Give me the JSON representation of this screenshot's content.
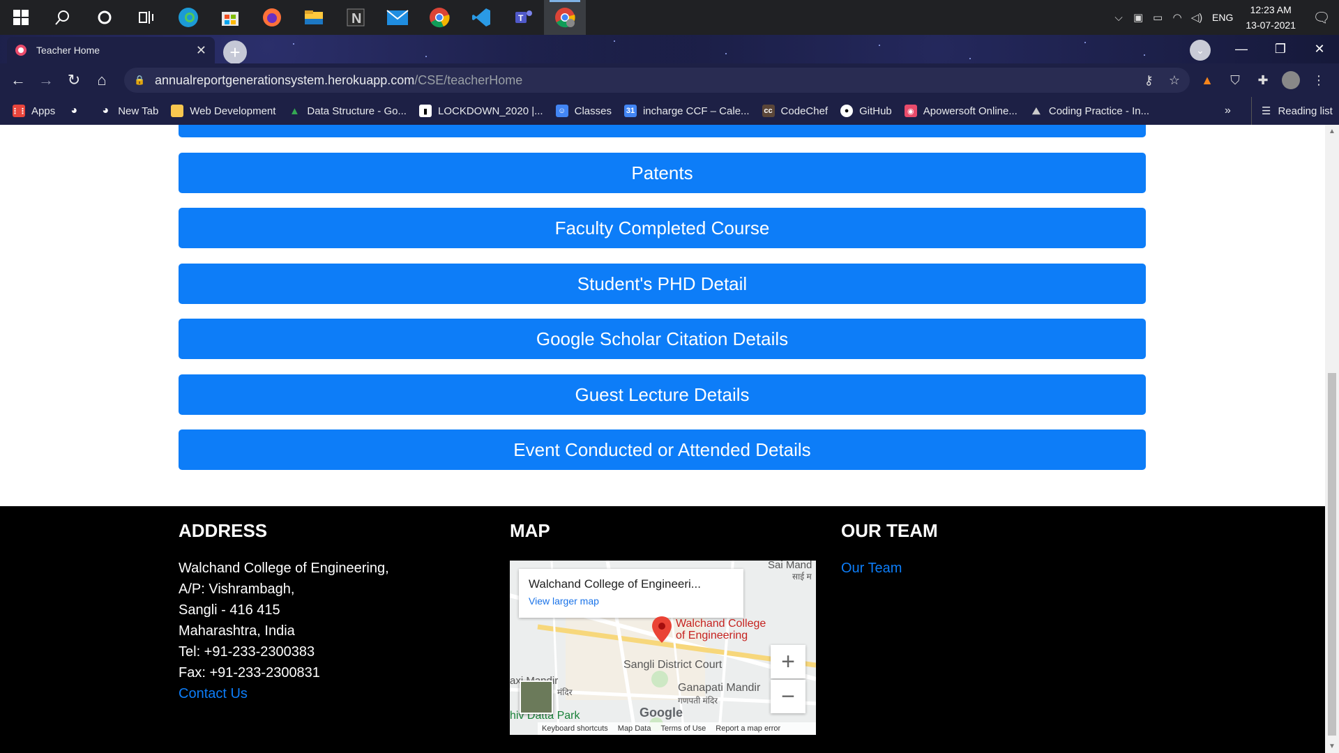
{
  "system": {
    "time": "12:23 AM",
    "date": "13-07-2021",
    "language": "ENG"
  },
  "browser": {
    "tab_title": "Teacher Home",
    "url_host": "annualreportgenerationsystem.herokuapp.com",
    "url_path": "/CSE/teacherHome",
    "bookmarks": [
      {
        "label": "Apps",
        "color": "#e8453c"
      },
      {
        "label": "",
        "color": "#3c4043"
      },
      {
        "label": "New Tab",
        "color": "#3c4043"
      },
      {
        "label": "Web Development",
        "color": "#f9c74f"
      },
      {
        "label": "Data Structure - Go...",
        "color": "#34a853"
      },
      {
        "label": "LOCKDOWN_2020 |...",
        "color": "#ffffff"
      },
      {
        "label": "Classes",
        "color": "#4285f4"
      },
      {
        "label": "incharge CCF – Cale...",
        "color": "#4285f4"
      },
      {
        "label": "CodeChef",
        "color": "#5b4638"
      },
      {
        "label": "GitHub",
        "color": "#ffffff"
      },
      {
        "label": "Apowersoft Online...",
        "color": "#e94b6b"
      },
      {
        "label": "Coding Practice - In...",
        "color": "#9aa0a6"
      }
    ],
    "bookmarks_more": "»",
    "reading_list": "Reading list"
  },
  "page": {
    "buttons": [
      "Patents",
      "Faculty Completed Course",
      "Student's PHD Detail",
      "Google Scholar Citation Details",
      "Guest Lecture Details",
      "Event Conducted or Attended Details"
    ],
    "accent_color": "#0d7df8"
  },
  "footer": {
    "address_heading": "ADDRESS",
    "address_lines": [
      "Walchand College of Engineering,",
      "A/P: Vishrambagh,",
      "Sangli - 416 415",
      "Maharashtra, India",
      "Tel: +91-233-2300383",
      "Fax: +91-233-2300831"
    ],
    "contact_link": "Contact Us",
    "map_heading": "MAP",
    "team_heading": "OUR TEAM",
    "team_link": "Our Team"
  },
  "map": {
    "place_title": "Walchand College of Engineeri...",
    "view_larger": "View larger map",
    "marker_label_1": "Walchand College",
    "marker_label_2": "of Engineering",
    "labels": {
      "sai": "Sai Mand",
      "sai_hi": "साई म",
      "court": "Sangli District Court",
      "mandir": "axi Mandir",
      "mandir_hi": "मंदिर",
      "ganapati": "Ganapati Mandir",
      "ganapati_hi": "गणपती मंदिर",
      "park": "hiv Datta Park",
      "google": "Google"
    },
    "zoom_in": "+",
    "zoom_out": "−",
    "attrib": [
      "Keyboard shortcuts",
      "Map Data",
      "Terms of Use",
      "Report a map error"
    ]
  }
}
